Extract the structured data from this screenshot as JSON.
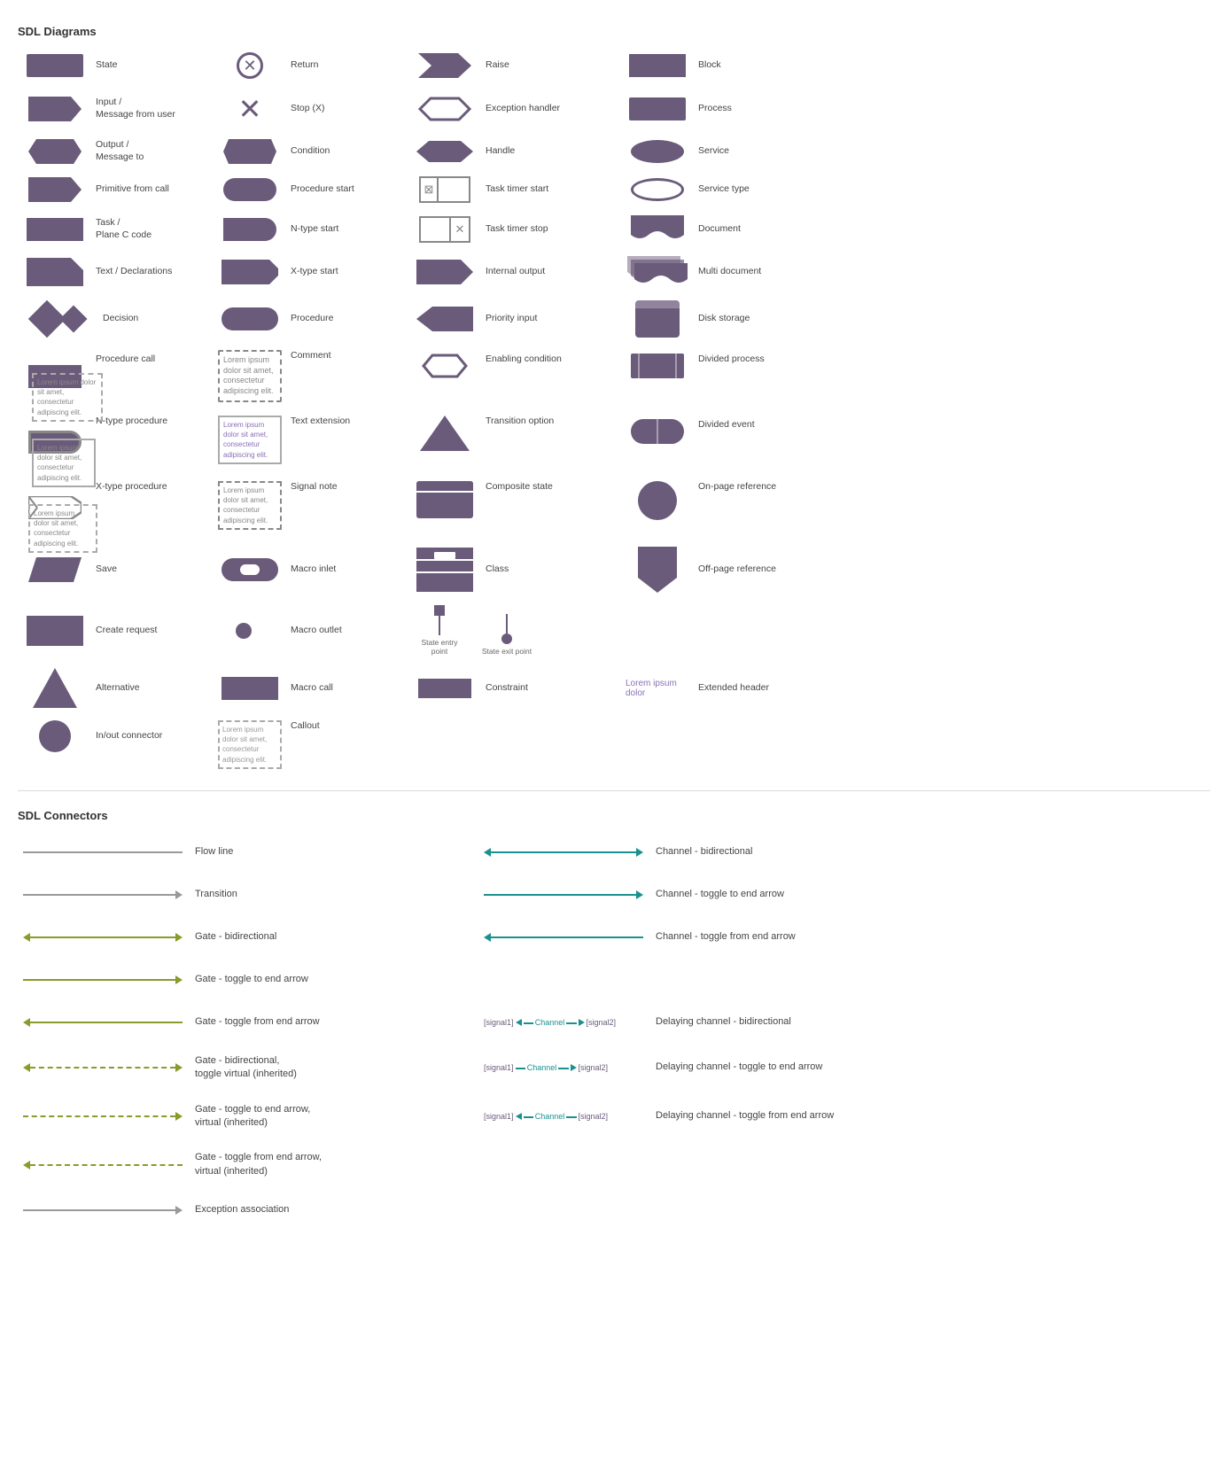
{
  "page": {
    "sections": {
      "sdl_diagrams": {
        "title": "SDL Diagrams",
        "items": [
          {
            "id": "state",
            "label": "State",
            "shape": "rect"
          },
          {
            "id": "return",
            "label": "Return",
            "shape": "circle-x"
          },
          {
            "id": "raise",
            "label": "Raise",
            "shape": "raise"
          },
          {
            "id": "block",
            "label": "Block",
            "shape": "rect-plain"
          },
          {
            "id": "input",
            "label": "Input /\nMessage from user",
            "shape": "pentagon"
          },
          {
            "id": "stop",
            "label": "Stop (X)",
            "shape": "x-mark"
          },
          {
            "id": "exception-handler",
            "label": "Exception handler",
            "shape": "exc-handler"
          },
          {
            "id": "process",
            "label": "Process",
            "shape": "rect-plain"
          },
          {
            "id": "output",
            "label": "Output /\nMessage to",
            "shape": "arrow-lr"
          },
          {
            "id": "condition",
            "label": "Condition",
            "shape": "hexagon"
          },
          {
            "id": "handle",
            "label": "Handle",
            "shape": "chevron"
          },
          {
            "id": "service",
            "label": "Service",
            "shape": "ellipse"
          },
          {
            "id": "prim-call",
            "label": "Primitive from call",
            "shape": "pentagon-right"
          },
          {
            "id": "procedure-start",
            "label": "Procedure start",
            "shape": "rounded-rect"
          },
          {
            "id": "task-timer-start",
            "label": "Task timer start",
            "shape": "task-timer"
          },
          {
            "id": "service-type",
            "label": "Service type",
            "shape": "ellipse-outline"
          },
          {
            "id": "task",
            "label": "Task /\nPlane C code",
            "shape": "rect"
          },
          {
            "id": "ntype-start",
            "label": "N-type start",
            "shape": "ntype-start"
          },
          {
            "id": "task-timer-stop",
            "label": "Task timer stop",
            "shape": "task-timer-stop"
          },
          {
            "id": "document",
            "label": "Document",
            "shape": "document"
          },
          {
            "id": "text-decl",
            "label": "Text / Declarations",
            "shape": "text-decl"
          },
          {
            "id": "xtype-start",
            "label": "X-type start",
            "shape": "xtype-start"
          },
          {
            "id": "internal-output",
            "label": "Internal output",
            "shape": "internal-output"
          },
          {
            "id": "multi-document",
            "label": "Multi document",
            "shape": "multi-doc"
          },
          {
            "id": "decision",
            "label": "Decision",
            "shape": "diamond-pair"
          },
          {
            "id": "procedure",
            "label": "Procedure",
            "shape": "procedure"
          },
          {
            "id": "priority-input",
            "label": "Priority input",
            "shape": "priority-input"
          },
          {
            "id": "disk-storage",
            "label": "Disk storage",
            "shape": "disk-storage"
          },
          {
            "id": "procedure-call",
            "label": "Procedure call",
            "shape": "rect-dashed-comment"
          },
          {
            "id": "comment",
            "label": "Comment",
            "shape": "dashed-rect"
          },
          {
            "id": "enabling-condition",
            "label": "Enabling condition",
            "shape": "enabling-condition"
          },
          {
            "id": "divided-process",
            "label": "Divided process",
            "shape": "divided-process"
          },
          {
            "id": "ntype-procedure",
            "label": "N-type procedure",
            "shape": "ntype-proc-dashed"
          },
          {
            "id": "text-extension",
            "label": "Text extension",
            "shape": "dashed-box"
          },
          {
            "id": "transition-option",
            "label": "Transition option",
            "shape": "triangle"
          },
          {
            "id": "divided-event",
            "label": "Divided event",
            "shape": "divided-event"
          },
          {
            "id": "xtype-procedure",
            "label": "X-type procedure",
            "shape": "xtype-proc"
          },
          {
            "id": "signal-note",
            "label": "Signal note",
            "shape": "signal-note"
          },
          {
            "id": "composite-state",
            "label": "Composite state",
            "shape": "composite-state"
          },
          {
            "id": "on-page-ref",
            "label": "On-page reference",
            "shape": "circle-big"
          },
          {
            "id": "save",
            "label": "Save",
            "shape": "parallelogram"
          },
          {
            "id": "macro-inlet",
            "label": "Macro inlet",
            "shape": "macro-inlet"
          },
          {
            "id": "class",
            "label": "Class",
            "shape": "class"
          },
          {
            "id": "off-page-ref",
            "label": "Off-page reference",
            "shape": "shield"
          },
          {
            "id": "create-request",
            "label": "Create request",
            "shape": "rect-tall"
          },
          {
            "id": "macro-outlet",
            "label": "Macro outlet",
            "shape": "small-circle"
          },
          {
            "id": "state-entry-exit",
            "label": "State entry point   State exit point",
            "shape": "state-entry-exit"
          },
          {
            "id": "constraint",
            "label": "Constraint",
            "shape": "rect-small"
          },
          {
            "id": "alternative",
            "label": "Alternative",
            "shape": "triangle-up"
          },
          {
            "id": "macro-call",
            "label": "Macro call",
            "shape": "rect-plain"
          },
          {
            "id": "extended-header",
            "label": "Extended header",
            "shape": "lorem-text"
          },
          {
            "id": "inout-connector",
            "label": "In/out connector",
            "shape": "circle-medium"
          },
          {
            "id": "callout",
            "label": "Callout",
            "shape": "callout-dashed"
          }
        ]
      },
      "sdl_connectors": {
        "title": "SDL Connectors",
        "items": [
          {
            "id": "flow-line",
            "label": "Flow line",
            "line_type": "solid-gray",
            "col": 1
          },
          {
            "id": "channel-bidir",
            "label": "Channel - bidirectional",
            "line_type": "teal-bidir",
            "col": 2
          },
          {
            "id": "transition",
            "label": "Transition",
            "line_type": "solid-gray-arrow",
            "col": 1
          },
          {
            "id": "channel-toggle-end",
            "label": "Channel - toggle to end arrow",
            "line_type": "teal-arrow",
            "col": 2
          },
          {
            "id": "gate-bidir",
            "label": "Gate - bidirectional",
            "line_type": "olive-bidir",
            "col": 1
          },
          {
            "id": "channel-toggle-from",
            "label": "Channel - toggle from end arrow",
            "line_type": "teal-left-arrow",
            "col": 2
          },
          {
            "id": "gate-toggle-end",
            "label": "Gate - toggle to end arrow",
            "line_type": "olive-arrow",
            "col": 1
          },
          {
            "id": "gate-toggle-from",
            "label": "Gate - toggle from end arrow",
            "line_type": "olive-left-arrow",
            "col": 1
          },
          {
            "id": "delaying-channel-bidir",
            "label": "Delaying channel - bidirectional",
            "line_type": "delaying-bidir",
            "col": 2
          },
          {
            "id": "gate-bidir-virtual",
            "label": "Gate - bidirectional,\ntoggle virtual (inherited)",
            "line_type": "olive-dashed-bidir",
            "col": 1
          },
          {
            "id": "delaying-channel-toggle-end",
            "label": "Delaying channel - toggle to end arrow",
            "line_type": "delaying-arrow",
            "col": 2
          },
          {
            "id": "gate-toggle-end-virtual",
            "label": "Gate - toggle to end arrow,\nvirtual (inherited)",
            "line_type": "olive-dashed-arrow",
            "col": 1
          },
          {
            "id": "delaying-channel-toggle-from",
            "label": "Delaying channel - toggle from end arrow",
            "line_type": "delaying-left-arrow",
            "col": 2
          },
          {
            "id": "gate-toggle-from-virtual",
            "label": "Gate - toggle from end arrow,\nvirtual (inherited)",
            "line_type": "olive-dashed-left",
            "col": 1
          },
          {
            "id": "exception-association",
            "label": "Exception association",
            "line_type": "solid-gray-arrow-long",
            "col": 1
          }
        ]
      }
    },
    "comment_text": "Lorem ipsum dolor sit amet, consectetur adipiscing elit.",
    "text_ext_text": "Lorem ipsum dolor sit amet, consectetur adipiscing elit.",
    "callout_text": "Lorem ipsum dolor sit amet, consectetur adipiscing elit.",
    "extended_header_text": "Lorem ipsum dolor",
    "delaying_signal1": "[signal1]",
    "delaying_channel": "Channel",
    "delaying_signal2": "[signal2]",
    "colors": {
      "purple": "#6b5b7b",
      "teal": "#1b9090",
      "olive": "#8b9a2a",
      "gray": "#999999"
    }
  }
}
